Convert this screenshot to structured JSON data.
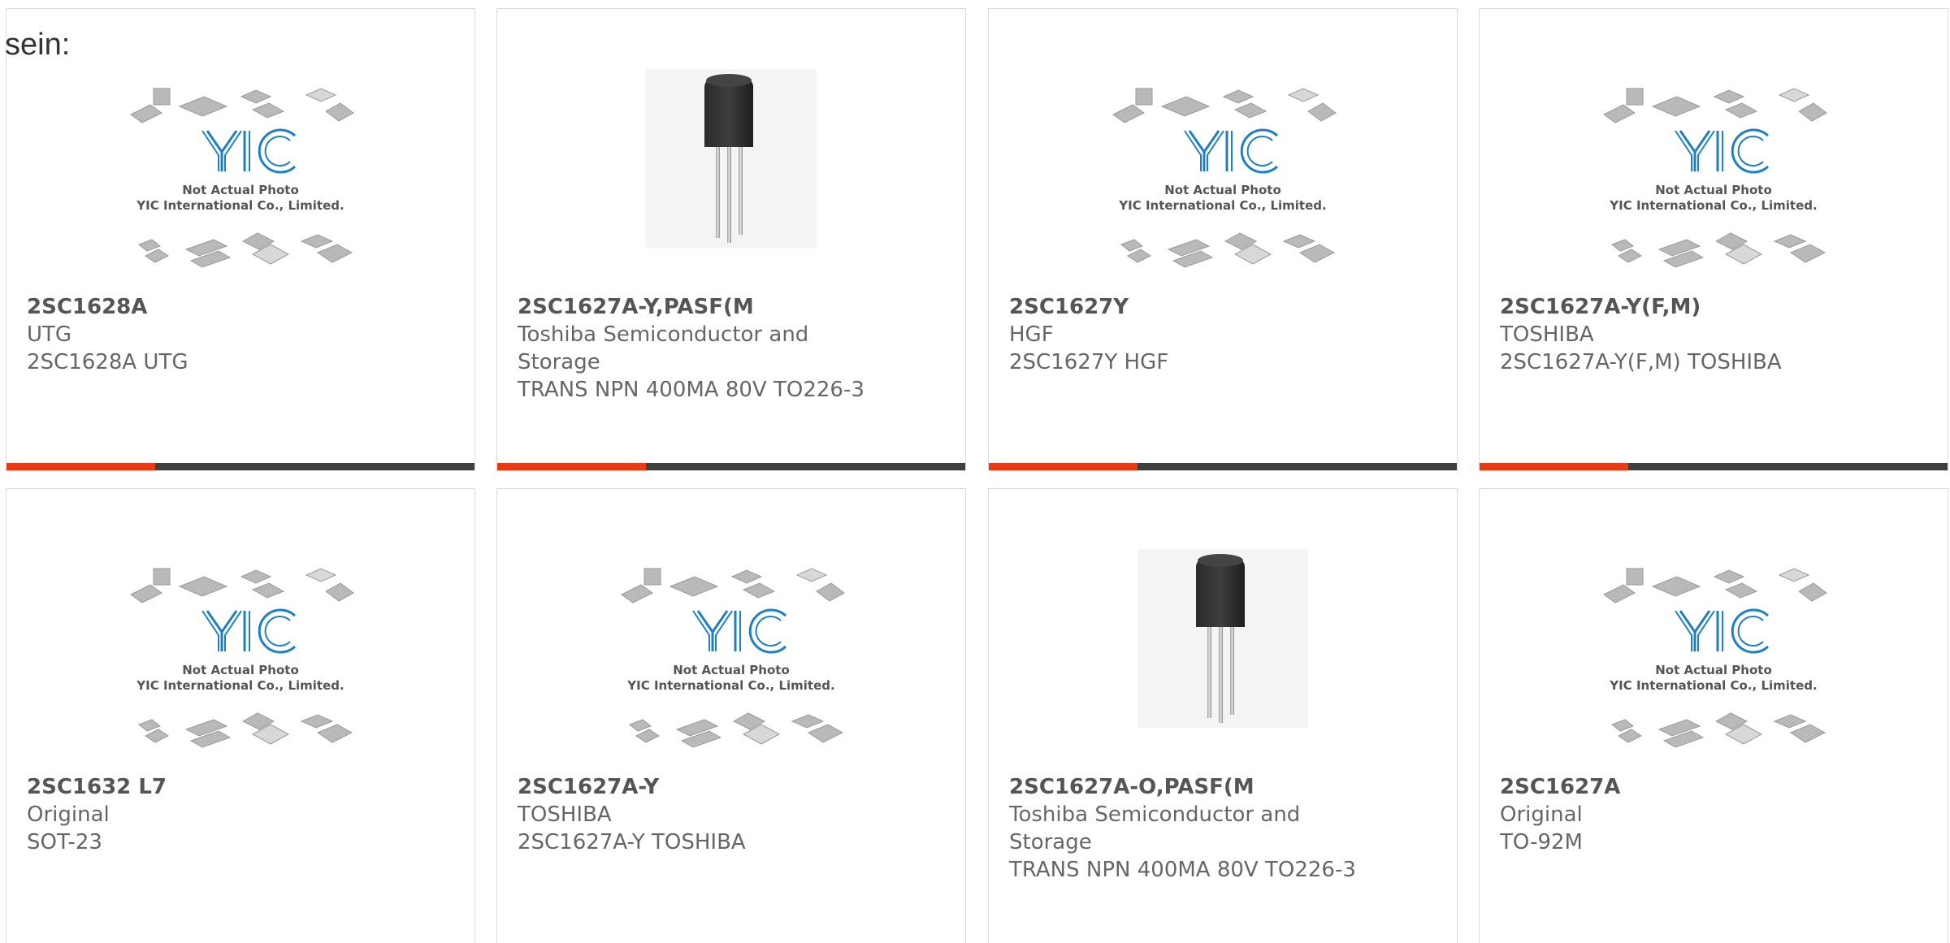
{
  "intro_text": "sein:",
  "colors": {
    "accent": "#e63b15",
    "bar_dark": "#3f3f3f",
    "logo_blue": "#1f7fc4",
    "border": "#dcdcdc"
  },
  "placeholder": {
    "line1": "Not Actual Photo",
    "line2": "YIC International Co., Limited."
  },
  "products": [
    {
      "title": "2SC1628A",
      "lines": [
        "UTG",
        "2SC1628A UTG"
      ],
      "image": "placeholder"
    },
    {
      "title": "2SC1627A-Y,PASF(M",
      "lines": [
        "Toshiba Semiconductor and",
        "Storage",
        "TRANS NPN 400MA 80V TO226-3"
      ],
      "image": "transistor"
    },
    {
      "title": "2SC1627Y",
      "lines": [
        "HGF",
        "2SC1627Y HGF"
      ],
      "image": "placeholder"
    },
    {
      "title": "2SC1627A-Y(F,M)",
      "lines": [
        "TOSHIBA",
        "2SC1627A-Y(F,M) TOSHIBA"
      ],
      "image": "placeholder"
    },
    {
      "title": "2SC1632 L7",
      "lines": [
        "Original",
        "SOT-23"
      ],
      "image": "placeholder"
    },
    {
      "title": "2SC1627A-Y",
      "lines": [
        "TOSHIBA",
        "2SC1627A-Y TOSHIBA"
      ],
      "image": "placeholder"
    },
    {
      "title": "2SC1627A-O,PASF(M",
      "lines": [
        "Toshiba Semiconductor and",
        "Storage",
        "TRANS NPN 400MA 80V TO226-3"
      ],
      "image": "transistor"
    },
    {
      "title": "2SC1627A",
      "lines": [
        "Original",
        "TO-92M"
      ],
      "image": "placeholder"
    }
  ]
}
